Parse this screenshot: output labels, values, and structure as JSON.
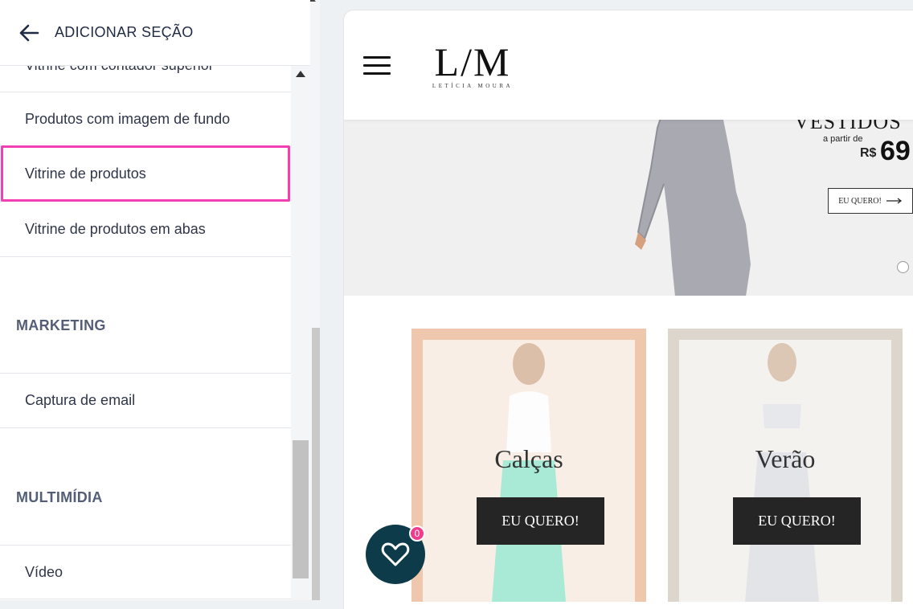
{
  "panel": {
    "title": "ADICIONAR SEÇÃO",
    "partial_item": "Vitrine com contador superior",
    "items_top": [
      "Produtos com imagem de fundo",
      "Vitrine de produtos",
      "Vitrine de produtos em abas"
    ],
    "selected": "Vitrine de produtos",
    "sections": [
      {
        "heading": "MARKETING",
        "items": [
          "Captura de email"
        ]
      },
      {
        "heading": "MULTIMÍDIA",
        "items": [
          "Vídeo"
        ]
      }
    ],
    "highlight_color": "#f23fb1"
  },
  "store": {
    "logo_mark": "L/M",
    "logo_sub": "LETÍCIA MOURA",
    "banner": {
      "title": "VESTIDOS",
      "from": "a partir de",
      "currency": "R$",
      "price": "69",
      "button": "EU QUERO!"
    },
    "categories": [
      {
        "label": "Calças",
        "button": "EU QUERO!",
        "bg": "#efc7ad"
      },
      {
        "label": "Verão",
        "button": "EU QUERO!",
        "bg": "#ddd6cc"
      }
    ],
    "wishlist_count": "0",
    "wishlist_color": "#0e3b4a"
  }
}
